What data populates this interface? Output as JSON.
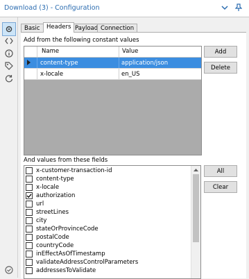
{
  "window": {
    "title": "Download (3) - Configuration"
  },
  "tabs": [
    {
      "label": "Basic",
      "active": false
    },
    {
      "label": "Headers",
      "active": true
    },
    {
      "label": "Payload",
      "active": false
    },
    {
      "label": "Connection",
      "active": false
    }
  ],
  "headers": {
    "section_label": "Add from the following constant values",
    "columns": [
      "Name",
      "Value"
    ],
    "rows": [
      {
        "name": "content-type",
        "value": "application/json",
        "selected": true
      },
      {
        "name": "x-locale",
        "value": "en_US",
        "selected": false
      }
    ],
    "add_label": "Add",
    "delete_label": "Delete"
  },
  "fields": {
    "section_label": "And values from these fields",
    "all_label": "All",
    "clear_label": "Clear",
    "items": [
      {
        "label": "x-customer-transaction-id",
        "checked": false
      },
      {
        "label": "content-type",
        "checked": false
      },
      {
        "label": "x-locale",
        "checked": false
      },
      {
        "label": "authorization",
        "checked": true
      },
      {
        "label": "url",
        "checked": false
      },
      {
        "label": "streetLines",
        "checked": false
      },
      {
        "label": "city",
        "checked": false
      },
      {
        "label": "stateOrProvinceCode",
        "checked": false
      },
      {
        "label": "postalCode",
        "checked": false
      },
      {
        "label": "countryCode",
        "checked": false
      },
      {
        "label": "inEffectAsOfTimestamp",
        "checked": false
      },
      {
        "label": "validateAddressControlParameters",
        "checked": false
      },
      {
        "label": "addressesToValidate",
        "checked": false
      }
    ]
  },
  "colors": {
    "accent": "#2b6cb0",
    "selection": "#3b8de0"
  },
  "icons": [
    "dropdown-icon",
    "pin-icon",
    "gear-icon",
    "code-icon",
    "info-icon",
    "tag-icon",
    "reset-icon",
    "check-circle-icon"
  ]
}
